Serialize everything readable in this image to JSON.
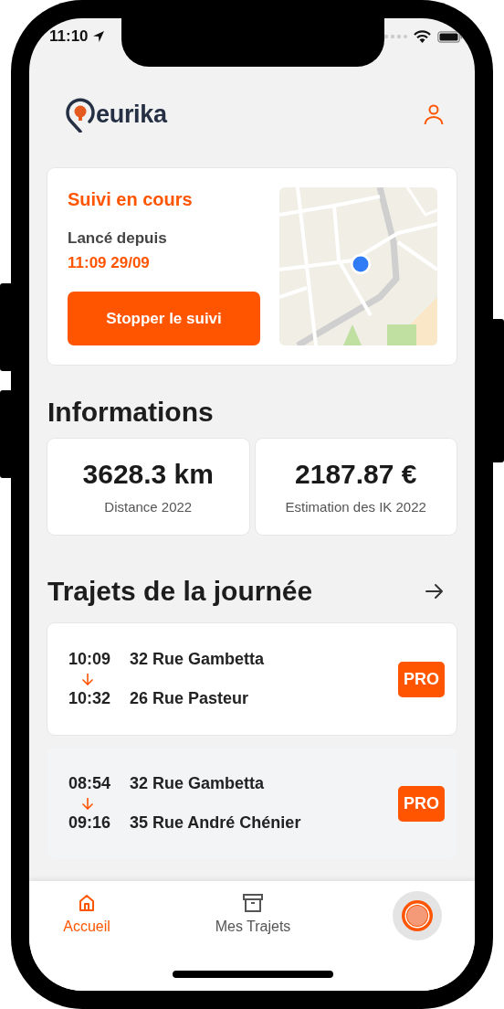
{
  "status_bar": {
    "time": "11:10"
  },
  "header": {
    "logo": "eurika"
  },
  "tracking": {
    "title": "Suivi en cours",
    "since_label": "Lancé depuis",
    "since_value": "11:09 29/09",
    "button": "Stopper le suivi"
  },
  "informations": {
    "title": "Informations",
    "stats": [
      {
        "value": "3628.3 km",
        "label": "Distance 2022"
      },
      {
        "value": "2187.87 €",
        "label": "Estimation des IK 2022"
      }
    ]
  },
  "trips": {
    "title": "Trajets de la journée",
    "items": [
      {
        "start_time": "10:09",
        "start_address": "32 Rue Gambetta",
        "end_time": "10:32",
        "end_address": "26 Rue Pasteur",
        "tag": "PRO",
        "pressed": false
      },
      {
        "start_time": "08:54",
        "start_address": "32 Rue Gambetta",
        "end_time": "09:16",
        "end_address": "35 Rue André Chénier",
        "tag": "PRO",
        "pressed": true
      }
    ]
  },
  "tab_bar": {
    "tabs": [
      {
        "label": "Accueil",
        "selected": true
      },
      {
        "label": "Mes Trajets",
        "selected": false
      }
    ]
  }
}
